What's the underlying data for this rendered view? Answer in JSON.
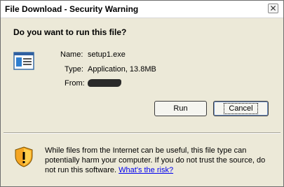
{
  "window": {
    "title": "File Download - Security Warning",
    "close_glyph": "✕"
  },
  "prompt": {
    "question": "Do you want to run this file?"
  },
  "file": {
    "name_label": "Name:",
    "name_value": "setup1.exe",
    "type_label": "Type:",
    "type_value": "Application, 13.8MB",
    "from_label": "From:",
    "from_value": ""
  },
  "buttons": {
    "run_label": "Run",
    "cancel_label": "Cancel"
  },
  "warning": {
    "text": "While files from the Internet can be useful, this file type can potentially harm your computer. If you do not trust the source, do not run this software.",
    "link": "What's the risk?"
  },
  "colors": {
    "accent": "#6e8fc4",
    "shield_orange": "#f5a623",
    "link": "#0000ee"
  }
}
